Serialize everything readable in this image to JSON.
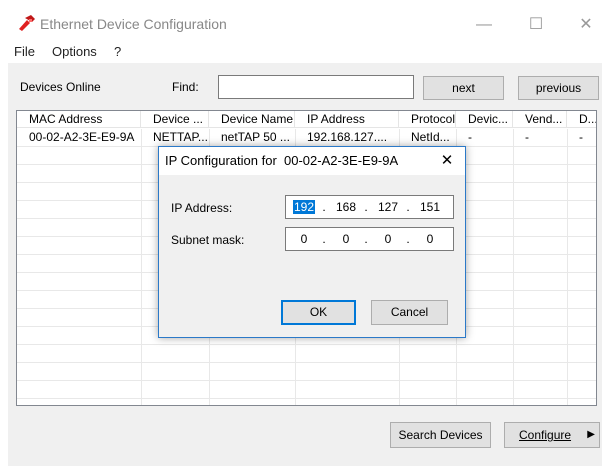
{
  "window": {
    "title": "Ethernet Device Configuration",
    "minimize": "—",
    "maximize": "☐",
    "close": "✕",
    "accent": "#e02020"
  },
  "menu": [
    "File",
    "Options",
    "?"
  ],
  "toolbar": {
    "devices_online": "Devices Online",
    "find_label": "Find:",
    "find_value": "",
    "next": "next",
    "previous": "previous"
  },
  "table": {
    "columns": [
      "MAC Address",
      "Device ...",
      "Device Name",
      "IP Address",
      "Protocol",
      "Devic...",
      "Vend...",
      "D..."
    ],
    "rows": [
      [
        "00-02-A2-3E-E9-9A",
        "NETTAP...",
        "netTAP 50 ...",
        "192.168.127....",
        "NetId...",
        "-",
        "-",
        "-"
      ]
    ]
  },
  "dialog": {
    "title": "IP Configuration for  00-02-A2-3E-E9-9A",
    "close": "✕",
    "ip_label": "IP Address:",
    "ip": [
      "192",
      "168",
      "127",
      "151"
    ],
    "mask_label": "Subnet mask:",
    "mask": [
      "0",
      "0",
      "0",
      "0"
    ],
    "ok": "OK",
    "cancel": "Cancel"
  },
  "bottom": {
    "search": "Search Devices",
    "configure": "Configure",
    "arrow": "▶"
  }
}
